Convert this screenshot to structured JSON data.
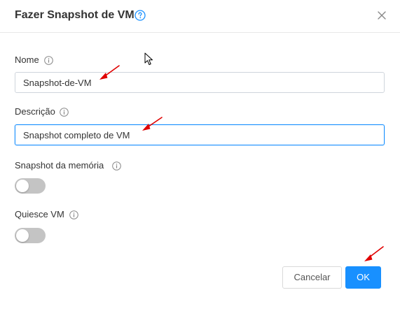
{
  "dialog": {
    "title": "Fazer Snapshot de VM",
    "help_icon": "question-circle-icon",
    "close_icon": "close-x-icon"
  },
  "form": {
    "name": {
      "label": "Nome",
      "value": "Snapshot-de-VM"
    },
    "description": {
      "label": "Descrição",
      "value": "Snapshot completo de VM"
    },
    "memory_snapshot": {
      "label": "Snapshot da memória",
      "enabled": false
    },
    "quiesce": {
      "label": "Quiesce VM",
      "enabled": false
    }
  },
  "buttons": {
    "cancel_label": "Cancelar",
    "ok_label": "OK"
  },
  "colors": {
    "accent": "#1890ff",
    "annotation_arrow": "#e00000",
    "toggle_off": "#c4c4c4"
  }
}
